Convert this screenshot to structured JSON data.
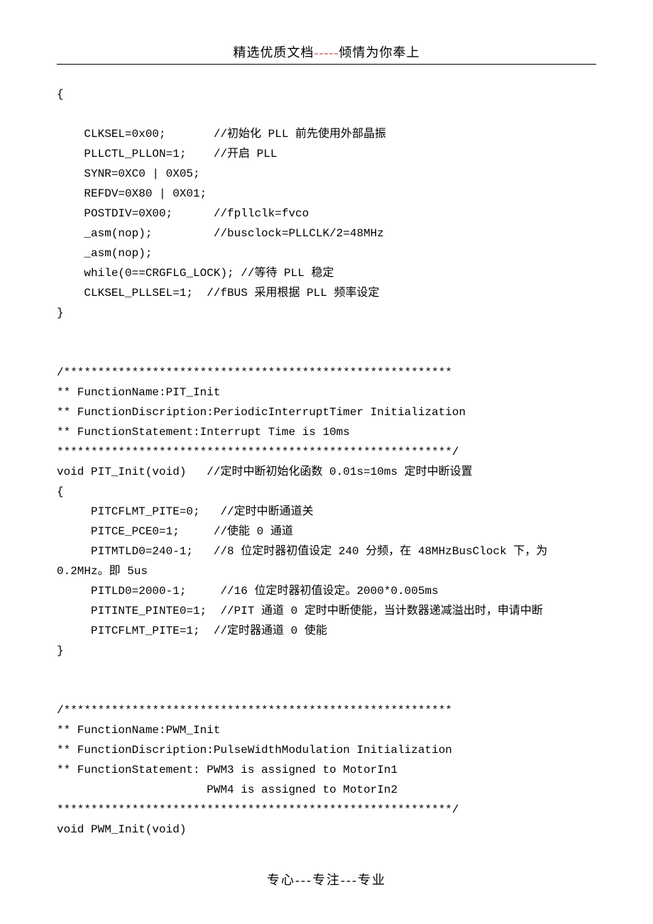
{
  "header": {
    "prefix": "精选优质文档",
    "separator": "-----",
    "suffix": "倾情为你奉上"
  },
  "code": {
    "line1": "{",
    "line2": "",
    "line3": "    CLKSEL=0x00;       //初始化 PLL 前先使用外部晶振",
    "line4": "    PLLCTL_PLLON=1;    //开启 PLL",
    "line5": "    SYNR=0XC0 | 0X05;",
    "line6": "    REFDV=0X80 | 0X01;",
    "line7": "    POSTDIV=0X00;      //fpllclk=fvco",
    "line8": "    _asm(nop);         //busclock=PLLCLK/2=48MHz",
    "line9": "    _asm(nop);",
    "line10": "    while(0==CRGFLG_LOCK); //等待 PLL 稳定",
    "line11": "    CLKSEL_PLLSEL=1;  //fBUS 采用根据 PLL 频率设定",
    "line12": "}",
    "line13": "",
    "line14": "",
    "line15": "/*********************************************************",
    "line16": "** FunctionName:PIT_Init",
    "line17": "** FunctionDiscription:PeriodicInterruptTimer Initialization",
    "line18": "** FunctionStatement:Interrupt Time is 10ms",
    "line19": "**********************************************************/",
    "line20": "void PIT_Init(void)   //定时中断初始化函数 0.01s=10ms 定时中断设置",
    "line21": "{",
    "line22": "     PITCFLMT_PITE=0;   //定时中断通道关",
    "line23": "     PITCE_PCE0=1;     //使能 0 通道",
    "line24": "     PITMTLD0=240-1;   //8 位定时器初值设定 240 分频，在 48MHzBusClock 下，为",
    "line25": "0.2MHz。即 5us",
    "line26": "     PITLD0=2000-1;     //16 位定时器初值设定。2000*0.005ms",
    "line27": "     PITINTE_PINTE0=1;  //PIT 通道 0 定时中断使能，当计数器递减溢出时，申请中断",
    "line28": "     PITCFLMT_PITE=1;  //定时器通道 0 使能",
    "line29": "}",
    "line30": "",
    "line31": "",
    "line32": "/*********************************************************",
    "line33": "** FunctionName:PWM_Init",
    "line34": "** FunctionDiscription:PulseWidthModulation Initialization",
    "line35": "** FunctionStatement: PWM3 is assigned to MotorIn1",
    "line36": "                      PWM4 is assigned to MotorIn2",
    "line37": "**********************************************************/",
    "line38": "void PWM_Init(void)"
  },
  "footer": {
    "text": "专心---专注---专业"
  }
}
